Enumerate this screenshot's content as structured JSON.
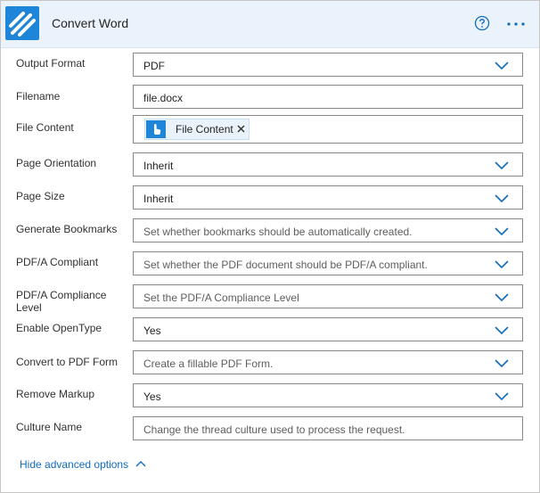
{
  "header": {
    "title": "Convert Word",
    "brand_color": "#1f85d8",
    "help_icon": "help-circle-icon",
    "more_icon": "more-horizontal-icon"
  },
  "fields": {
    "output_format": {
      "label": "Output Format",
      "value": "PDF"
    },
    "filename": {
      "label": "Filename",
      "value": "file.docx"
    },
    "file_content": {
      "label": "File Content",
      "token": "File Content"
    },
    "page_orientation": {
      "label": "Page Orientation",
      "value": "Inherit"
    },
    "page_size": {
      "label": "Page Size",
      "value": "Inherit"
    },
    "generate_bookmarks": {
      "label": "Generate Bookmarks",
      "placeholder": "Set whether bookmarks should be automatically created."
    },
    "pdfa_compliant": {
      "label": "PDF/A Compliant",
      "placeholder": "Set whether the PDF document should be PDF/A compliant."
    },
    "pdfa_level": {
      "label_line1": "PDF/A Compliance",
      "label_line2": "Level",
      "placeholder": "Set the PDF/A Compliance Level"
    },
    "enable_opentype": {
      "label": "Enable OpenType",
      "value": "Yes"
    },
    "convert_pdf_form": {
      "label": "Convert to PDF Form",
      "placeholder": "Create a fillable PDF Form."
    },
    "remove_markup": {
      "label": "Remove Markup",
      "value": "Yes"
    },
    "culture_name": {
      "label": "Culture Name",
      "placeholder": "Change the thread culture used to process the request."
    }
  },
  "footer": {
    "advanced_toggle": "Hide advanced options"
  }
}
